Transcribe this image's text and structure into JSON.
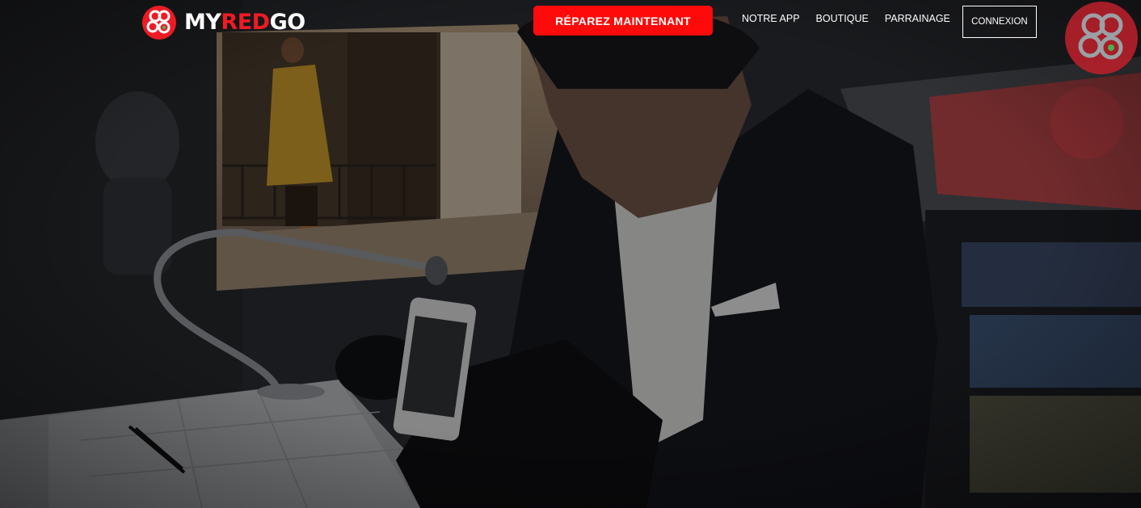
{
  "brand": {
    "name_part1": "MY",
    "name_part2": "RED",
    "name_part3": "GO",
    "logo_icon": "myredgo-logo-icon",
    "primary_color": "#ee1b24",
    "cta_color": "#ff0a0a"
  },
  "header": {
    "cta_label": "RÉPAREZ MAINTENANT",
    "nav": [
      {
        "label": "NOTRE APP"
      },
      {
        "label": "BOUTIQUE"
      },
      {
        "label": "PARRAINAGE"
      }
    ],
    "login_label": "CONNEXION"
  },
  "hero": {
    "image": "technician-repairing-iphone-in-van",
    "corner_icon": "myredgo-badge-icon"
  }
}
